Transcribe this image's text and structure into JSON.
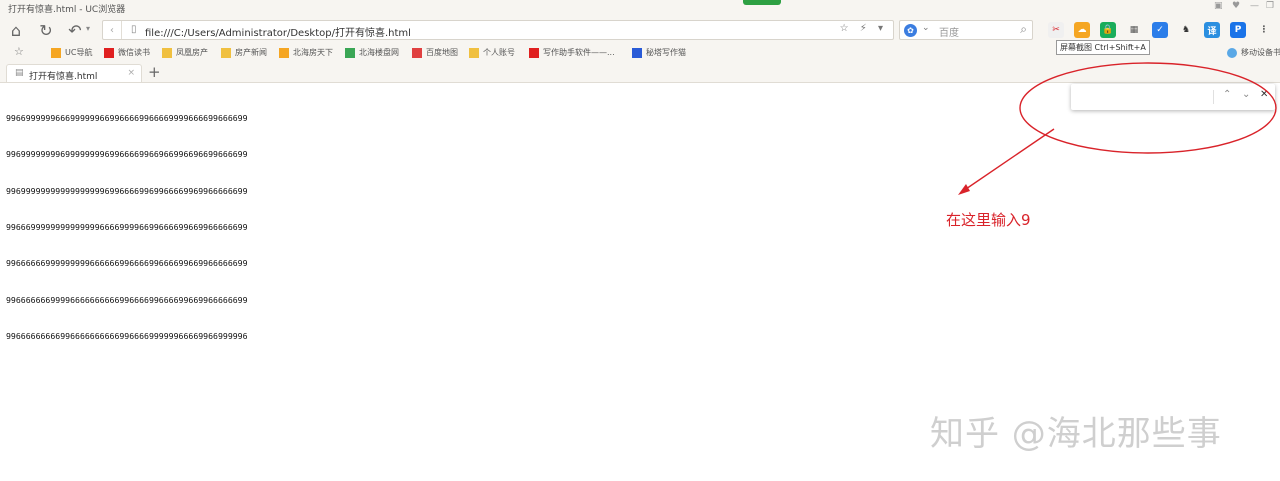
{
  "window": {
    "title": "打开有惊喜.html - UC浏览器",
    "controls": [
      "▣",
      "♥",
      "—",
      "❐"
    ]
  },
  "nav": {
    "home_icon": "⌂",
    "reload_icon": "↻",
    "undo_icon": "↶",
    "undo_chevron": "▾",
    "back_icon": "‹",
    "address": "file:///C:/Users/Administrator/Desktop/打开有惊喜.html",
    "address_right_icons": "☆ ⚡ ▾",
    "search_placeholder": "百度",
    "search_engine_icon": "✿",
    "search_chevron": "⌄",
    "search_icon": "⌕",
    "screenshot_tooltip": "屏幕截图 Ctrl+Shift+A"
  },
  "extensions": [
    {
      "name": "scissors-icon",
      "glyph": "✂",
      "color": "#f0f0f0",
      "fg": "#d9232a"
    },
    {
      "name": "cloud-icon",
      "glyph": "☁",
      "color": "#f5a623",
      "fg": "#ffffff"
    },
    {
      "name": "lock-icon",
      "glyph": "🔒",
      "color": "#1aad5b",
      "fg": "#ffffff"
    },
    {
      "name": "qr-icon",
      "glyph": "▦",
      "color": "#f7f5f1",
      "fg": "#555555"
    },
    {
      "name": "check-icon",
      "glyph": "✓",
      "color": "#2b7de9",
      "fg": "#ffffff"
    },
    {
      "name": "evernote-icon",
      "glyph": "♞",
      "color": "#f7f5f1",
      "fg": "#333333"
    },
    {
      "name": "translate-icon",
      "glyph": "译",
      "color": "#2b8fe0",
      "fg": "#ffffff"
    },
    {
      "name": "p-icon",
      "glyph": "P",
      "color": "#1a73e8",
      "fg": "#ffffff"
    },
    {
      "name": "menu-icon",
      "glyph": "⋮",
      "color": "#f7f5f1",
      "fg": "#555555"
    }
  ],
  "bookmarks": {
    "star_icon": "☆",
    "items": [
      {
        "label": "UC导航",
        "color": "#f5a623"
      },
      {
        "label": "微信读书",
        "color": "#e02020"
      },
      {
        "label": "凤凰房产",
        "color": "#f0c040"
      },
      {
        "label": "房产新闻",
        "color": "#f0c040"
      },
      {
        "label": "北海房天下",
        "color": "#f5a623"
      },
      {
        "label": "北海楼盘网",
        "color": "#3aa655"
      },
      {
        "label": "百度地图",
        "color": "#e04040"
      },
      {
        "label": "个人账号",
        "color": "#f0c040"
      },
      {
        "label": "写作助手软件——...",
        "color": "#e02020"
      },
      {
        "label": "秘塔写作猫",
        "color": "#2a5bd7"
      }
    ],
    "mobile_device": "移动设备书"
  },
  "tab": {
    "title": "打开有惊喜.html",
    "close_icon": "×",
    "new_tab_icon": "+",
    "doc_icon": "▤"
  },
  "content": {
    "lines": [
      "9966999999666999999669966669966669999666699666699",
      "9969999999969999999969966669966966996696699666699",
      "9969999999999999999969966669969966669969966666699",
      "9966699999999999999666699996699666699669966666699",
      "9966666699999999966666699666699666699669966666699",
      "9966666669999666666666699666699666699669966666699",
      "9966666666699666666666699666699999966669966999996"
    ]
  },
  "findbar": {
    "value": "",
    "up_icon": "⌃",
    "down_icon": "⌄",
    "close_icon": "✕"
  },
  "annotation": {
    "text": "在这里输入9",
    "color": "#d9232a"
  },
  "watermark": {
    "text": "知乎 @海北那些事"
  }
}
